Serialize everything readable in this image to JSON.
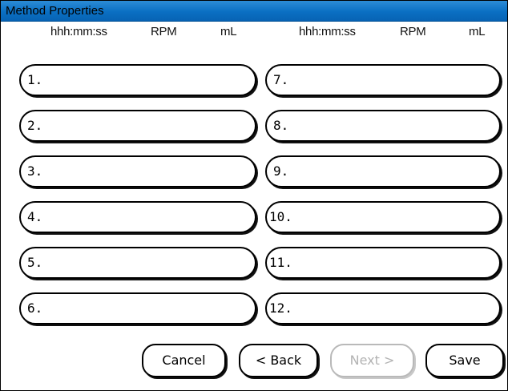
{
  "window": {
    "title": "Method Properties"
  },
  "columns": {
    "left": {
      "time": "hhh:mm:ss",
      "rpm": "RPM",
      "volume": "mL"
    },
    "right": {
      "time": "hhh:mm:ss",
      "rpm": "RPM",
      "volume": "mL"
    }
  },
  "steps": [
    {
      "label": "1."
    },
    {
      "label": "2."
    },
    {
      "label": "3."
    },
    {
      "label": "4."
    },
    {
      "label": "5."
    },
    {
      "label": "6."
    },
    {
      "label": "7."
    },
    {
      "label": "8."
    },
    {
      "label": "9."
    },
    {
      "label": "10."
    },
    {
      "label": "11."
    },
    {
      "label": "12."
    }
  ],
  "buttons": {
    "cancel": "Cancel",
    "back": "< Back",
    "next": "Next >",
    "save": "Save"
  },
  "state": {
    "next_enabled": false
  },
  "colors": {
    "titlebar": "#0a6fc3",
    "disabled_text": "#b3b3b3"
  }
}
